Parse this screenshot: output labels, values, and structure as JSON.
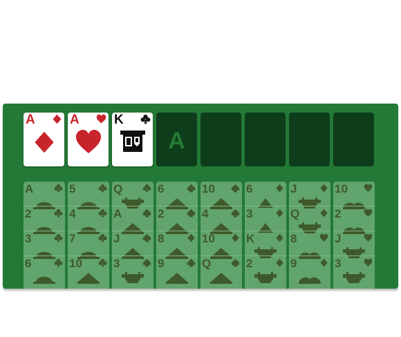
{
  "colors": {
    "board": "#237a36",
    "empty_slot": "#0e3d1b",
    "faded_card": "#61a46d",
    "faded_ink": "#3f5a2a",
    "red": "#c8242b",
    "black": "#111111"
  },
  "top_row": [
    {
      "rank": "A",
      "suit": "diamond",
      "color": "red",
      "face": "up"
    },
    {
      "rank": "A",
      "suit": "heart",
      "color": "red",
      "face": "up"
    },
    {
      "rank": "K",
      "suit": "club",
      "color": "black",
      "face": "up"
    },
    {
      "label": "A",
      "face": "empty"
    },
    {
      "label": "",
      "face": "empty"
    },
    {
      "label": "",
      "face": "empty"
    },
    {
      "label": "",
      "face": "empty"
    },
    {
      "label": "",
      "face": "empty"
    }
  ],
  "tableau": [
    {
      "cards": [
        {
          "rank": "A",
          "suit": "club",
          "art": "dome"
        },
        {
          "rank": "2",
          "suit": "club",
          "art": "dome"
        },
        {
          "rank": "3",
          "suit": "club",
          "art": "dome"
        },
        {
          "rank": "6",
          "suit": "club",
          "art": "dome"
        }
      ]
    },
    {
      "cards": [
        {
          "rank": "5",
          "suit": "club",
          "art": "dome"
        },
        {
          "rank": "4",
          "suit": "club",
          "art": "dome"
        },
        {
          "rank": "7",
          "suit": "club",
          "art": "dome"
        },
        {
          "rank": "10",
          "suit": "club",
          "art": "mountain"
        }
      ]
    },
    {
      "cards": [
        {
          "rank": "Q",
          "suit": "club",
          "art": "bridge"
        },
        {
          "rank": "A",
          "suit": "spade",
          "art": "mountain"
        },
        {
          "rank": "J",
          "suit": "spade",
          "art": "mountain"
        },
        {
          "rank": "3",
          "suit": "spade",
          "art": "bridge"
        }
      ]
    },
    {
      "cards": [
        {
          "rank": "6",
          "suit": "spade",
          "art": "mountain"
        },
        {
          "rank": "2",
          "suit": "spade",
          "art": "mountain"
        },
        {
          "rank": "8",
          "suit": "diamond",
          "art": "mountain"
        },
        {
          "rank": "9",
          "suit": "spade",
          "art": "mountain"
        }
      ]
    },
    {
      "cards": [
        {
          "rank": "10",
          "suit": "spade",
          "art": "mountain"
        },
        {
          "rank": "4",
          "suit": "spade",
          "art": "mountain"
        },
        {
          "rank": "10",
          "suit": "diamond",
          "art": "mountain"
        },
        {
          "rank": "Q",
          "suit": "spade",
          "art": "mountain"
        }
      ]
    },
    {
      "cards": [
        {
          "rank": "6",
          "suit": "diamond",
          "art": "triangle"
        },
        {
          "rank": "3",
          "suit": "diamond",
          "art": "triangle"
        },
        {
          "rank": "K",
          "suit": "diamond",
          "art": "bridge"
        },
        {
          "rank": "2",
          "suit": "diamond",
          "art": "bridge"
        }
      ]
    },
    {
      "cards": [
        {
          "rank": "J",
          "suit": "diamond",
          "art": "bridge"
        },
        {
          "rank": "Q",
          "suit": "diamond",
          "art": "bridge"
        },
        {
          "rank": "8",
          "suit": "heart",
          "art": "hearts"
        },
        {
          "rank": "9",
          "suit": "diamond",
          "art": "hearts"
        }
      ]
    },
    {
      "cards": [
        {
          "rank": "10",
          "suit": "heart",
          "art": "hearts"
        },
        {
          "rank": "2",
          "suit": "heart",
          "art": "hearts"
        },
        {
          "rank": "J",
          "suit": "heart",
          "art": "bridge"
        },
        {
          "rank": "3",
          "suit": "heart",
          "art": "bridge"
        }
      ]
    }
  ]
}
